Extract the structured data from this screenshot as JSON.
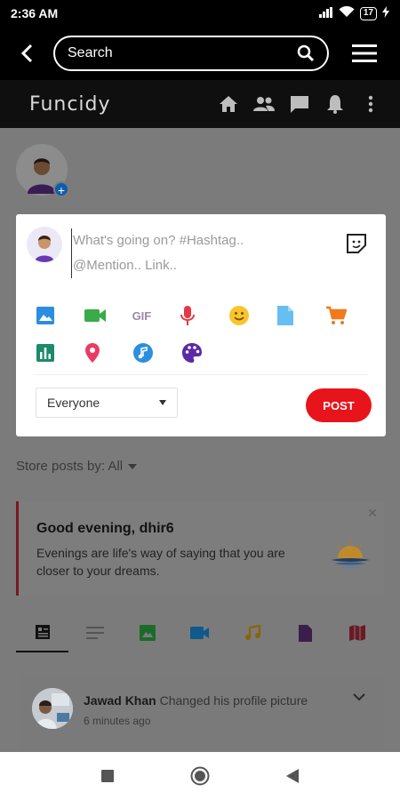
{
  "status_bar": {
    "time": "2:36 AM",
    "battery": "17"
  },
  "search": {
    "label": "Search"
  },
  "brand": {
    "name": "Funcidy"
  },
  "composer": {
    "placeholder_line1": "What's going on? #Hashtag..",
    "placeholder_line2": "@Mention.. Link..",
    "gif_label": "GIF",
    "privacy_value": "Everyone",
    "post_label": "POST"
  },
  "sort": {
    "label": "Store posts by: All"
  },
  "greeting": {
    "title": "Good evening, dhir6",
    "body": "Evenings are life's way of saying that you are closer to your dreams."
  },
  "feed": {
    "post": {
      "author": "Jawad Khan",
      "action": "Changed his profile picture",
      "time": "6 minutes ago"
    }
  },
  "colors": {
    "accent_red": "#e8141b",
    "icon_blue": "#2d8de0",
    "icon_green": "#3aaa4a",
    "icon_mic_red": "#e53945",
    "icon_yellow": "#f8c52d",
    "icon_doc_blue": "#66bff0",
    "icon_cart_orange": "#f07a1c",
    "icon_chart_teal": "#1d8a6b",
    "icon_pin_pink": "#ea3b62",
    "icon_music_blue": "#2a8fe0",
    "icon_palette_purple": "#5c2aa6"
  }
}
